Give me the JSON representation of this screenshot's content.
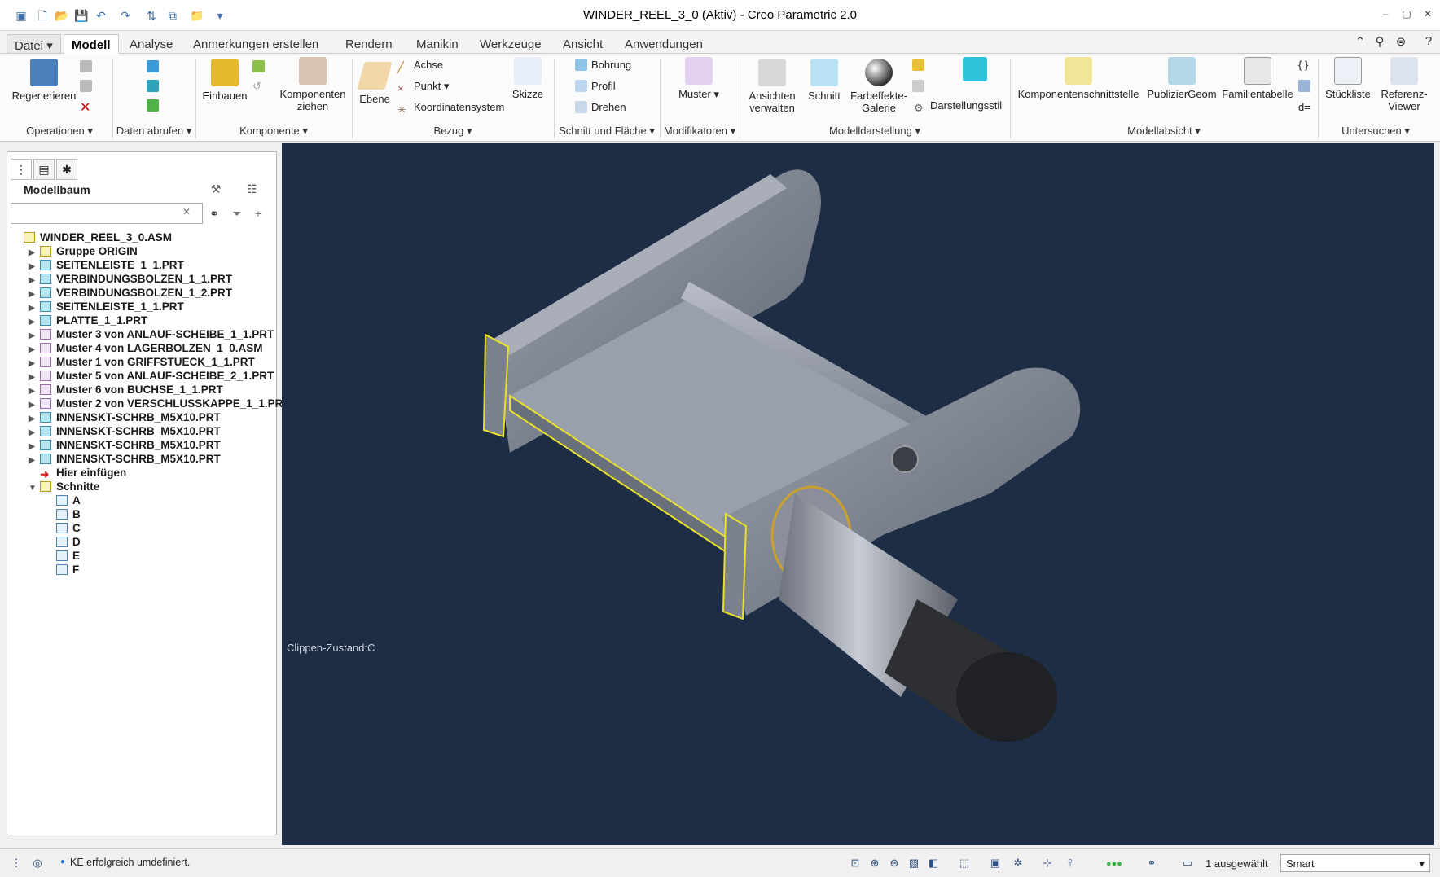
{
  "window": {
    "title": "WINDER_REEL_3_0 (Aktiv) - Creo Parametric 2.0"
  },
  "tabs": [
    {
      "label": "Datei"
    },
    {
      "label": "Modell"
    },
    {
      "label": "Analyse"
    },
    {
      "label": "Anmerkungen erstellen"
    },
    {
      "label": "Rendern"
    },
    {
      "label": "Manikin"
    },
    {
      "label": "Werkzeuge"
    },
    {
      "label": "Ansicht"
    },
    {
      "label": "Anwendungen"
    }
  ],
  "ribbon": {
    "big": [
      {
        "label": "Regenerieren"
      },
      {
        "label": "Einbauen"
      },
      {
        "label": "Komponenten ziehen"
      },
      {
        "label": "Ebene"
      },
      {
        "label": "Skizze"
      },
      {
        "label": "Muster"
      },
      {
        "label": "Ansichten verwalten"
      },
      {
        "label": "Schnitt"
      },
      {
        "label": "Farbeffekte-Galerie"
      },
      {
        "label": "Komponentenschnittstelle"
      },
      {
        "label": "PublizierGeom"
      },
      {
        "label": "Familientabelle"
      },
      {
        "label": "Stückliste"
      },
      {
        "label": "Referenz-Viewer"
      }
    ],
    "small": {
      "achse": "Achse",
      "punkt": "Punkt",
      "koordinatensystem": "Koordinatensystem",
      "bohrung": "Bohrung",
      "profil": "Profil",
      "drehen": "Drehen",
      "darstellungsstil": "Darstellungsstil"
    },
    "groups": [
      {
        "label": "Operationen"
      },
      {
        "label": "Daten abrufen"
      },
      {
        "label": "Komponente"
      },
      {
        "label": "Bezug"
      },
      {
        "label": "Schnitt und Fläche"
      },
      {
        "label": "Modifikatoren"
      },
      {
        "label": "Modelldarstellung"
      },
      {
        "label": "Modellabsicht"
      },
      {
        "label": "Untersuchen"
      }
    ]
  },
  "panel": {
    "title": "Modellbaum",
    "search_placeholder": ""
  },
  "tree": [
    {
      "label": "WINDER_REEL_3_0.ASM",
      "type": "asm",
      "level": 0,
      "arrow": ""
    },
    {
      "label": "Gruppe ORIGIN",
      "type": "group",
      "level": 1,
      "arrow": "▶"
    },
    {
      "label": "SEITENLEISTE_1_1.PRT",
      "type": "prt",
      "level": 1,
      "arrow": "▶"
    },
    {
      "label": "VERBINDUNGSBOLZEN_1_1.PRT",
      "type": "prt",
      "level": 1,
      "arrow": "▶"
    },
    {
      "label": "VERBINDUNGSBOLZEN_1_2.PRT",
      "type": "prt",
      "level": 1,
      "arrow": "▶"
    },
    {
      "label": "SEITENLEISTE_1_1.PRT",
      "type": "prt",
      "level": 1,
      "arrow": "▶"
    },
    {
      "label": "PLATTE_1_1.PRT",
      "type": "prt",
      "level": 1,
      "arrow": "▶"
    },
    {
      "label": "Muster 3 von ANLAUF-SCHEIBE_1_1.PRT",
      "type": "muster",
      "level": 1,
      "arrow": "▶"
    },
    {
      "label": "Muster 4 von LAGERBOLZEN_1_0.ASM",
      "type": "muster",
      "level": 1,
      "arrow": "▶"
    },
    {
      "label": "Muster 1 von GRIFFSTUECK_1_1.PRT",
      "type": "muster",
      "level": 1,
      "arrow": "▶"
    },
    {
      "label": "Muster 5 von ANLAUF-SCHEIBE_2_1.PRT",
      "type": "muster",
      "level": 1,
      "arrow": "▶"
    },
    {
      "label": "Muster 6 von BUCHSE_1_1.PRT",
      "type": "muster",
      "level": 1,
      "arrow": "▶"
    },
    {
      "label": "Muster 2 von VERSCHLUSSKAPPE_1_1.PRT",
      "type": "muster",
      "level": 1,
      "arrow": "▶"
    },
    {
      "label": "INNENSKT-SCHRB_M5X10.PRT",
      "type": "prt",
      "level": 1,
      "arrow": "▶"
    },
    {
      "label": "INNENSKT-SCHRB_M5X10.PRT",
      "type": "prt",
      "level": 1,
      "arrow": "▶"
    },
    {
      "label": "INNENSKT-SCHRB_M5X10.PRT",
      "type": "prt",
      "level": 1,
      "arrow": "▶"
    },
    {
      "label": "INNENSKT-SCHRB_M5X10.PRT",
      "type": "prt",
      "level": 1,
      "arrow": "▶"
    },
    {
      "label": "Hier einfügen",
      "type": "insert",
      "level": 1,
      "arrow": ""
    },
    {
      "label": "Schnitte",
      "type": "folder",
      "level": 1,
      "arrow": "▼"
    },
    {
      "label": "A",
      "type": "sec",
      "level": 2,
      "arrow": ""
    },
    {
      "label": "B",
      "type": "sec",
      "level": 2,
      "arrow": ""
    },
    {
      "label": "C",
      "type": "sec",
      "level": 2,
      "arrow": ""
    },
    {
      "label": "D",
      "type": "sec",
      "level": 2,
      "arrow": ""
    },
    {
      "label": "E",
      "type": "sec",
      "level": 2,
      "arrow": ""
    },
    {
      "label": "F",
      "type": "sec",
      "level": 2,
      "arrow": ""
    }
  ],
  "viewport": {
    "clip_state": "Clippen-Zustand:C"
  },
  "status": {
    "message": "KE erfolgreich umdefiniert.",
    "selected": "1 ausgewählt",
    "filter": "Smart"
  }
}
